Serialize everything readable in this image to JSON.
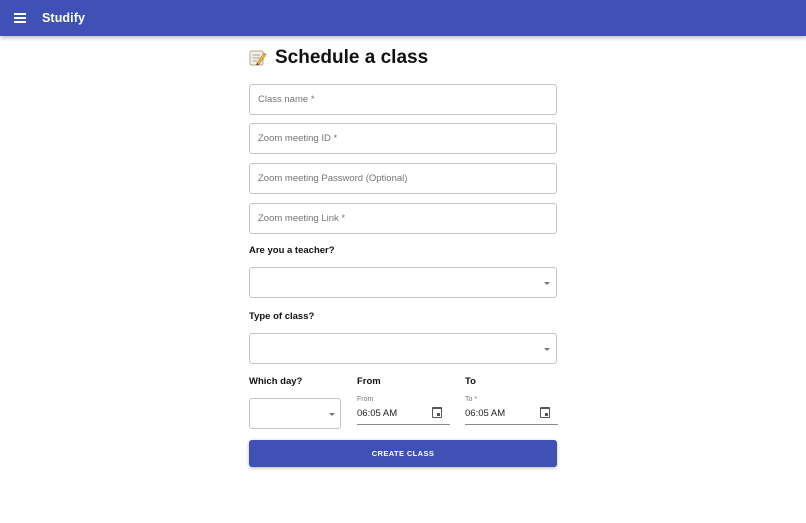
{
  "appbar": {
    "title": "Studify",
    "menu_icon": "menu-icon",
    "color": "#3f51b5"
  },
  "page": {
    "heading_icon": "memo-icon",
    "heading": "Schedule a class"
  },
  "form": {
    "class_name_placeholder": "Class name *",
    "zoom_id_placeholder": "Zoom meeting ID *",
    "zoom_password_placeholder": "Zoom meeting Password (Optional)",
    "zoom_link_placeholder": "Zoom meeting Link *",
    "teacher_question": "Are you a teacher?",
    "teacher_value": "",
    "class_type_question": "Type of class?",
    "class_type_value": "",
    "day_label": "Which day?",
    "day_value": "",
    "from_label": "From",
    "from_field_label": "From",
    "from_value": "06:05 AM",
    "to_label": "To",
    "to_field_label": "To *",
    "to_value": "06:05 AM",
    "submit_label": "CREATE CLASS"
  }
}
